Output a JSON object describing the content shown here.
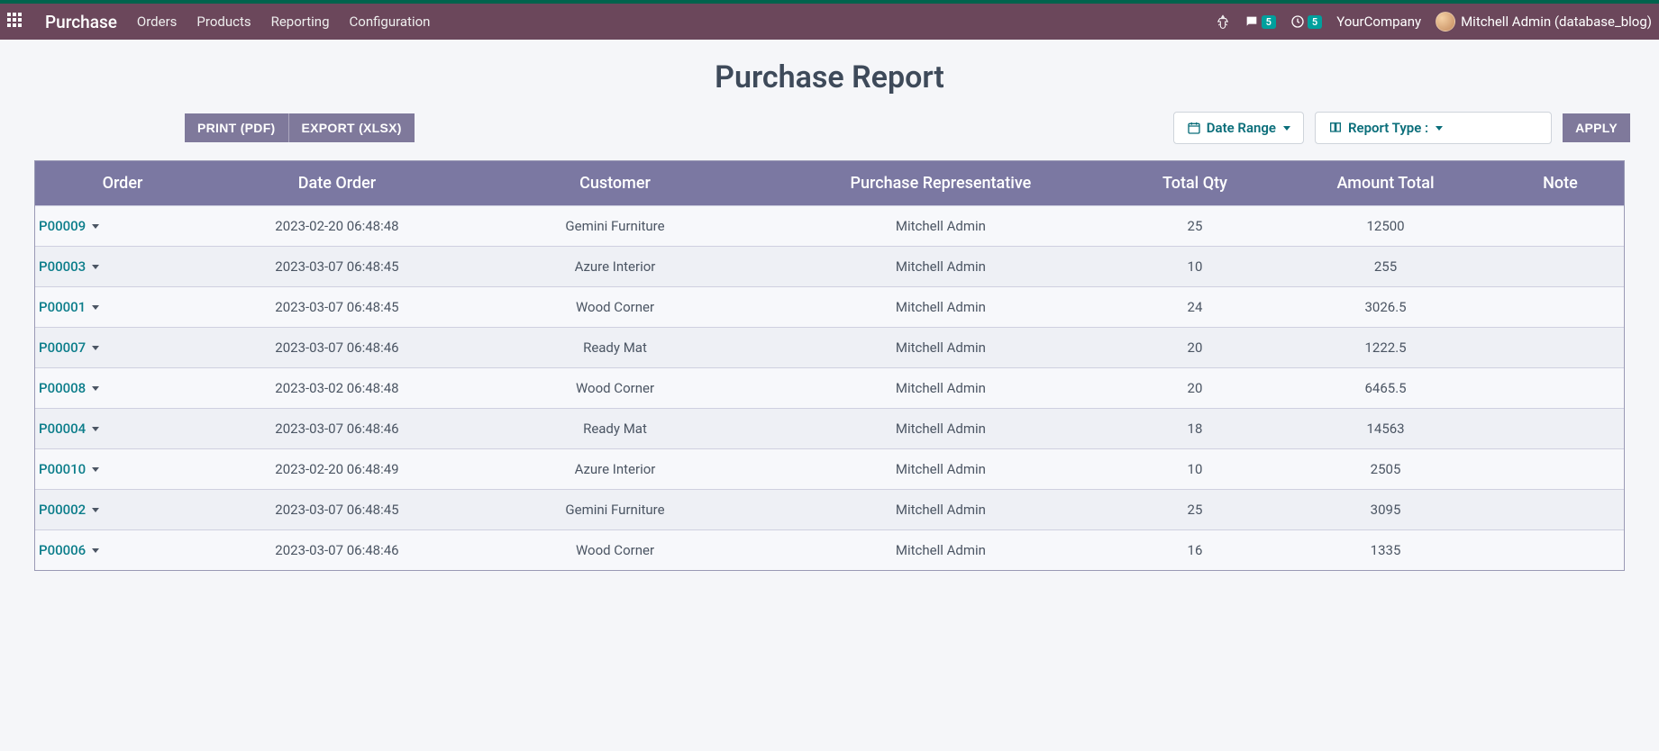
{
  "nav": {
    "brand": "Purchase",
    "items": [
      "Orders",
      "Products",
      "Reporting",
      "Configuration"
    ],
    "messages_badge": "5",
    "activities_badge": "5",
    "company": "YourCompany",
    "user": "Mitchell Admin (database_blog)"
  },
  "page": {
    "title": "Purchase Report"
  },
  "toolbar": {
    "print_label": "Print (PDF)",
    "export_label": "Export (XLSX)",
    "date_range_label": "Date Range",
    "report_type_label": "Report Type :",
    "apply_label": "Apply"
  },
  "table": {
    "headers": {
      "order": "Order",
      "date": "Date Order",
      "customer": "Customer",
      "rep": "Purchase Representative",
      "qty": "Total Qty",
      "amount": "Amount Total",
      "note": "Note"
    },
    "rows": [
      {
        "order": "P00009",
        "date": "2023-02-20 06:48:48",
        "customer": "Gemini Furniture",
        "rep": "Mitchell Admin",
        "qty": "25",
        "amount": "12500",
        "note": ""
      },
      {
        "order": "P00003",
        "date": "2023-03-07 06:48:45",
        "customer": "Azure Interior",
        "rep": "Mitchell Admin",
        "qty": "10",
        "amount": "255",
        "note": ""
      },
      {
        "order": "P00001",
        "date": "2023-03-07 06:48:45",
        "customer": "Wood Corner",
        "rep": "Mitchell Admin",
        "qty": "24",
        "amount": "3026.5",
        "note": ""
      },
      {
        "order": "P00007",
        "date": "2023-03-07 06:48:46",
        "customer": "Ready Mat",
        "rep": "Mitchell Admin",
        "qty": "20",
        "amount": "1222.5",
        "note": ""
      },
      {
        "order": "P00008",
        "date": "2023-03-02 06:48:48",
        "customer": "Wood Corner",
        "rep": "Mitchell Admin",
        "qty": "20",
        "amount": "6465.5",
        "note": ""
      },
      {
        "order": "P00004",
        "date": "2023-03-07 06:48:46",
        "customer": "Ready Mat",
        "rep": "Mitchell Admin",
        "qty": "18",
        "amount": "14563",
        "note": ""
      },
      {
        "order": "P00010",
        "date": "2023-02-20 06:48:49",
        "customer": "Azure Interior",
        "rep": "Mitchell Admin",
        "qty": "10",
        "amount": "2505",
        "note": ""
      },
      {
        "order": "P00002",
        "date": "2023-03-07 06:48:45",
        "customer": "Gemini Furniture",
        "rep": "Mitchell Admin",
        "qty": "25",
        "amount": "3095",
        "note": ""
      },
      {
        "order": "P00006",
        "date": "2023-03-07 06:48:46",
        "customer": "Wood Corner",
        "rep": "Mitchell Admin",
        "qty": "16",
        "amount": "1335",
        "note": ""
      }
    ]
  }
}
